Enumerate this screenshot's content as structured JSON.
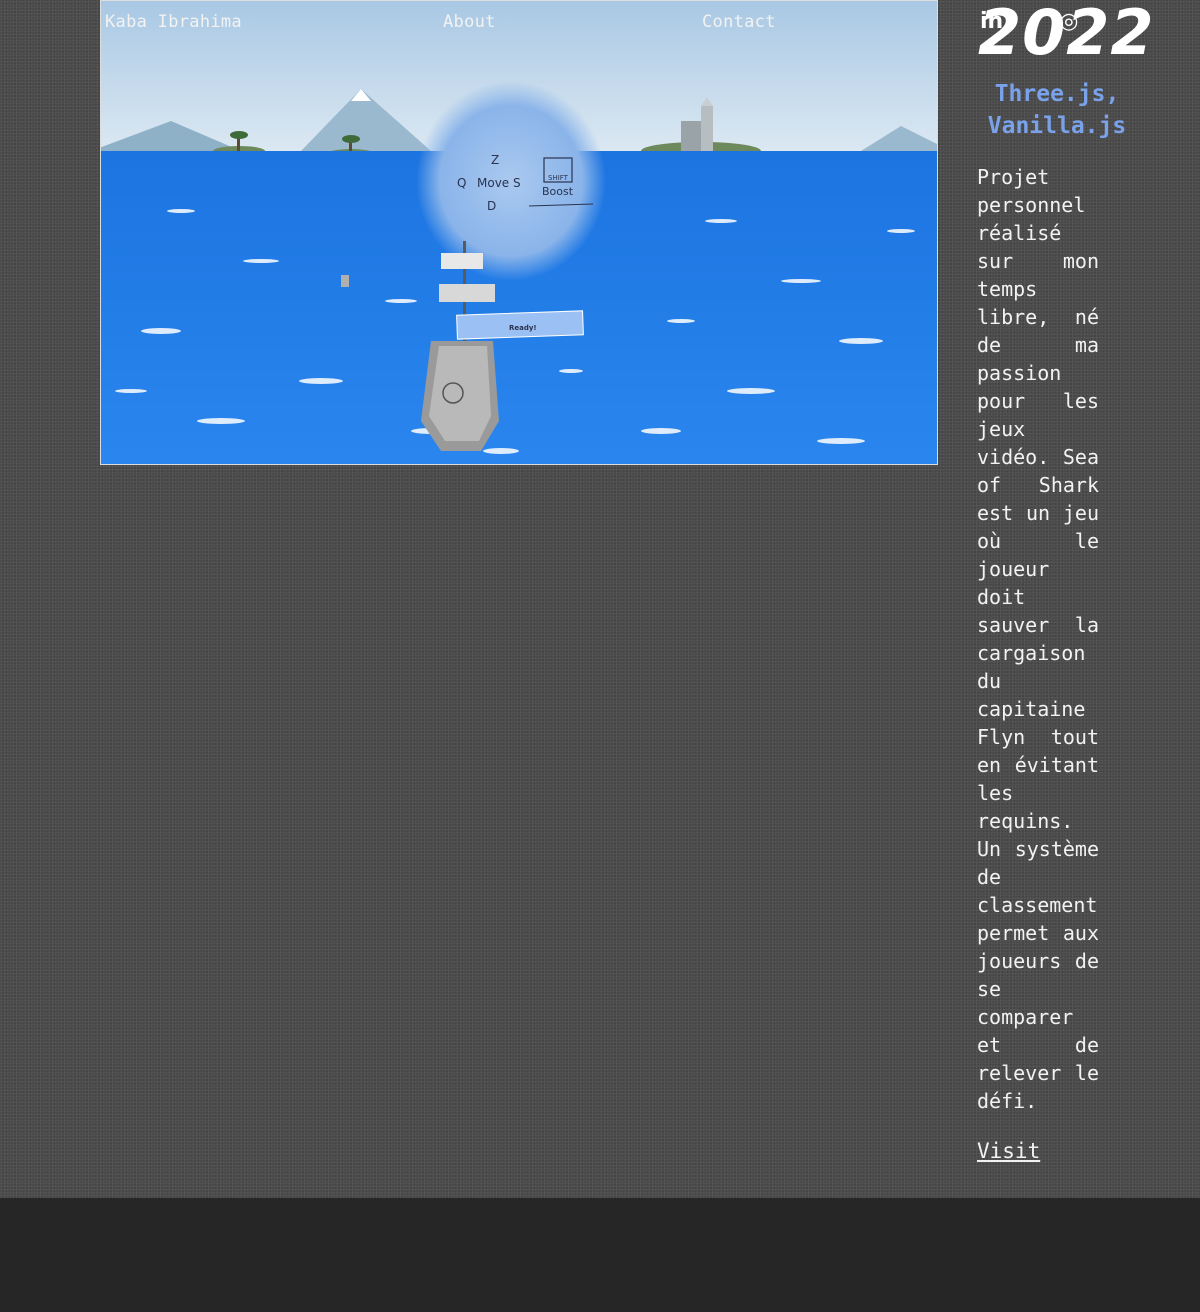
{
  "nav": {
    "name": "Kaba Ibrahima",
    "about": "About",
    "contact": "Contact",
    "social": [
      {
        "icon": "linkedin-icon",
        "glyph": "in"
      },
      {
        "icon": "instagram-icon",
        "glyph": "◎"
      }
    ]
  },
  "project": {
    "year": "2022",
    "tech": "Three.js, Vanilla.js",
    "description": "Projet personnel réalisé sur mon temps libre, né de ma passion pour les jeux vidéo. Sea of Shark est un jeu où le joueur doit sauver la cargaison du capitaine Flyn tout en évitant les requins. Un système de classement permet aux joueurs de se comparer et de relever le défi.",
    "visit_label": "Visit",
    "game_hud": {
      "key_up": "Z",
      "key_left": "Q",
      "key_right": "S",
      "key_down": "D",
      "move_label": "Move",
      "shift_label": "SHIFT",
      "boost_label": "Boost",
      "ready_label": "Ready!"
    }
  },
  "colors": {
    "accent": "#7aa2ea",
    "sea": "#1f7de6",
    "sky": "#bcd6ea",
    "background": "#262626"
  }
}
